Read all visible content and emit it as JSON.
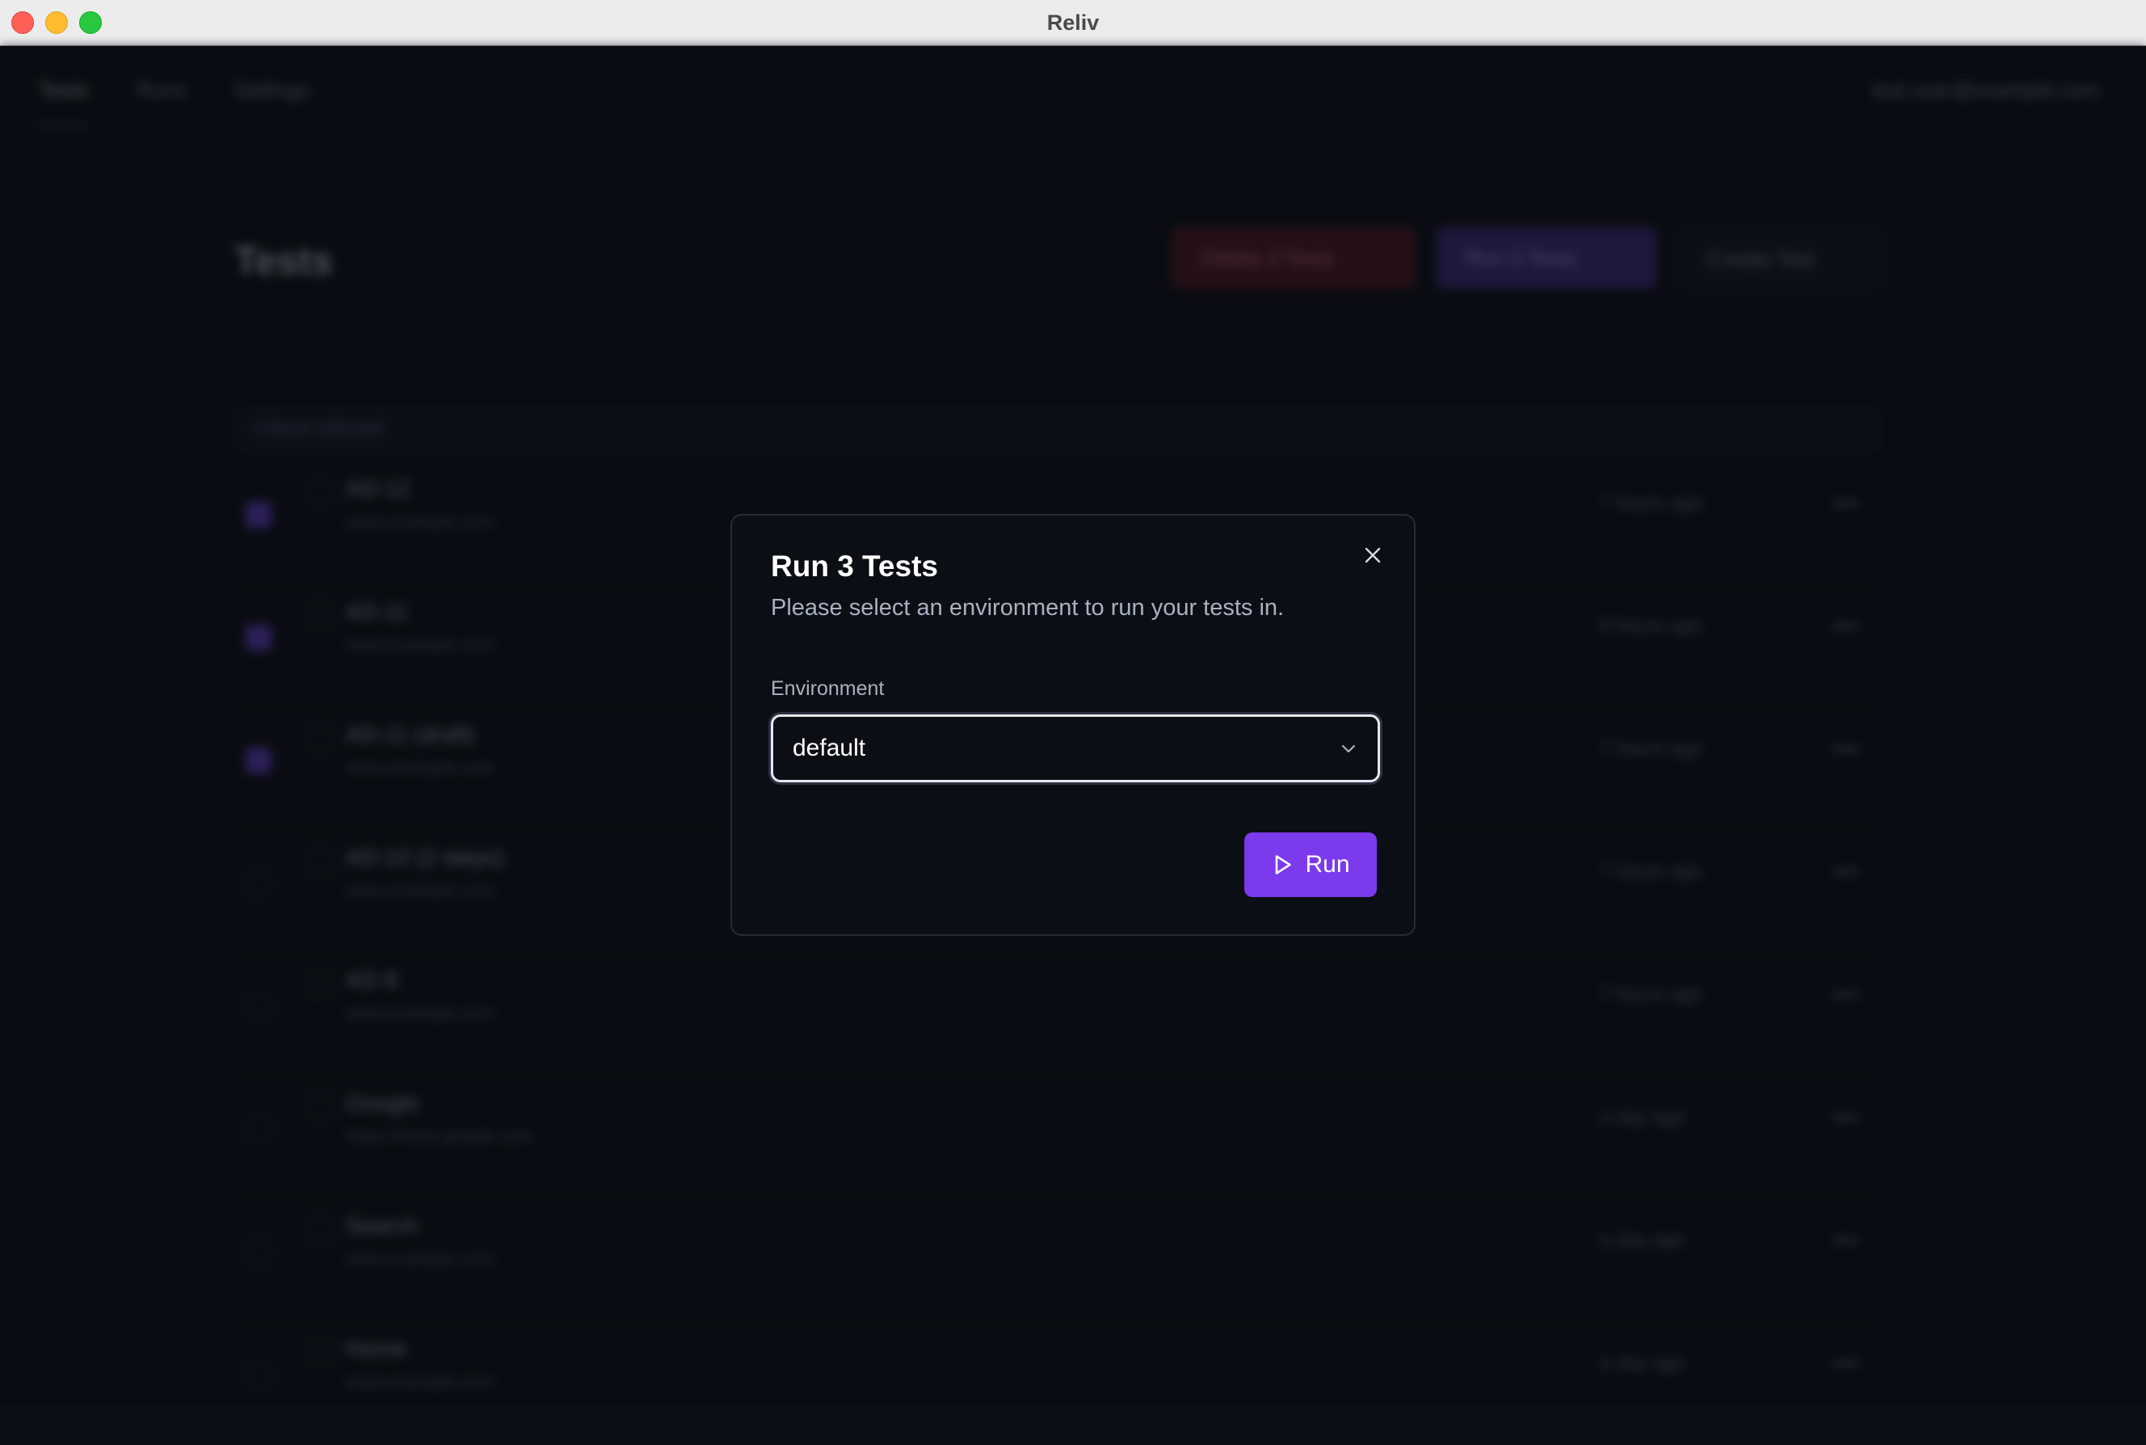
{
  "window": {
    "title": "Reliv"
  },
  "background": {
    "nav": [
      "Tests",
      "Runs",
      "Settings"
    ],
    "user_email": "test.user@example.com",
    "page_title": "Tests",
    "actions": {
      "delete": "Delete 3 Tests",
      "run": "Run 3 Tests",
      "create": "Create Test"
    },
    "selected_text": "3 items selected",
    "rows": [
      {
        "name": "AD-12",
        "sub": "www.example.com",
        "time": "7 hours ago",
        "checked": true
      },
      {
        "name": "AD-11",
        "sub": "www.example.com",
        "time": "8 hours ago",
        "checked": true
      },
      {
        "name": "AD-11 (draft)",
        "sub": "www.example.com",
        "time": "7 hours ago",
        "checked": true
      },
      {
        "name": "AD-10 (2 steps)",
        "sub": "www.example.com",
        "time": "7 hours ago",
        "checked": false
      },
      {
        "name": "AD-9",
        "sub": "www.example.com",
        "time": "7 hours ago",
        "checked": false
      },
      {
        "name": "Google",
        "sub": "https://www.google.com",
        "time": "a day ago",
        "checked": false
      },
      {
        "name": "Search",
        "sub": "www.example.com",
        "time": "a day ago",
        "checked": false
      },
      {
        "name": "Home",
        "sub": "www.example.com",
        "time": "a day ago",
        "checked": false
      }
    ]
  },
  "modal": {
    "title": "Run 3 Tests",
    "description": "Please select an environment to run your tests in.",
    "field_label": "Environment",
    "selected_environment": "default",
    "run_label": "Run"
  },
  "colors": {
    "accent": "#7c3aed",
    "background": "#0b0e14",
    "border": "#252b38"
  }
}
